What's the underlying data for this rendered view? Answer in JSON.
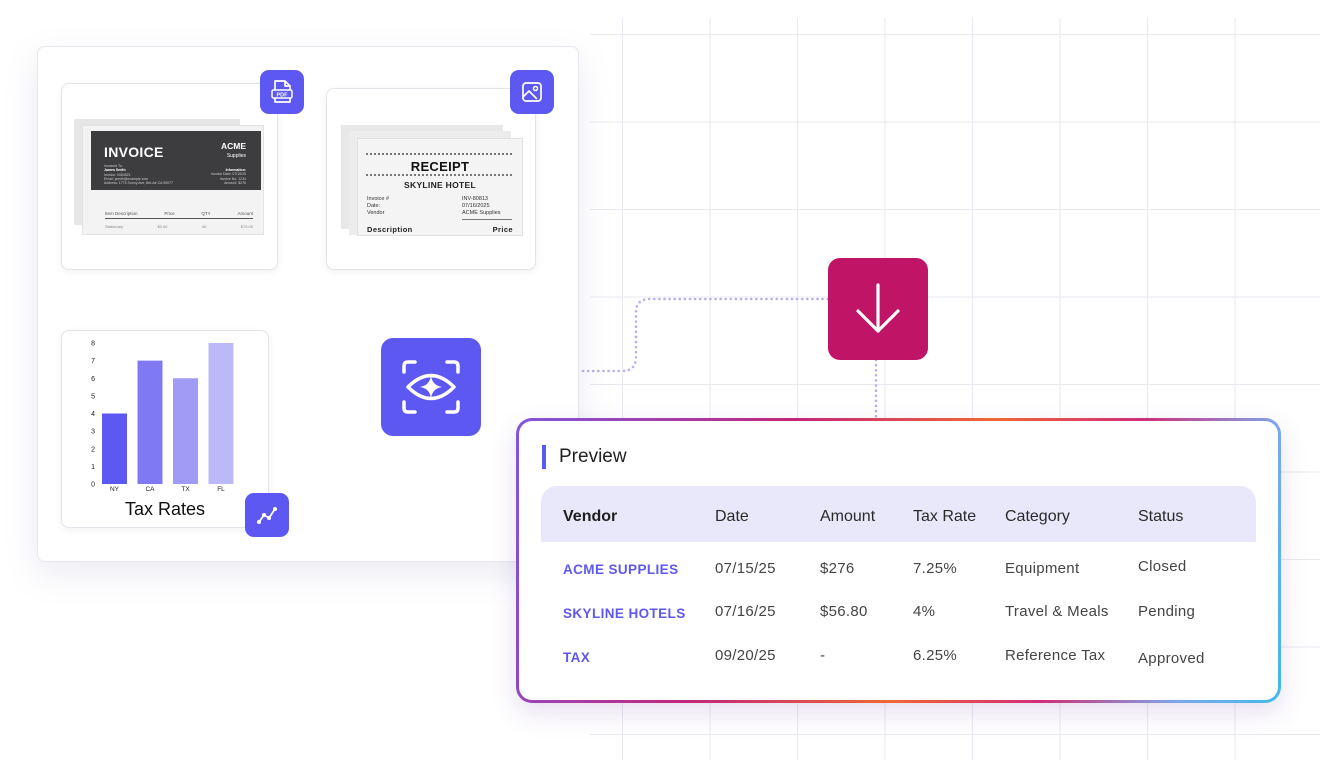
{
  "documents": {
    "invoice": {
      "badge_icon": "pdf-file-icon",
      "badge_text": "PDF",
      "title": "INVOICE",
      "brand_name": "ACME",
      "brand_sub": "Supplies",
      "billed_to": "Invoiced To:",
      "client": "James Smith",
      "line1": "Invoice: 0084521",
      "line2": "Email: jsmith@example.com",
      "line3": "Address: 1774 Sunny Ave, Bel-Air CA 90077",
      "info_label": "Information:",
      "info1": "Invoice Date: 07/15/25",
      "info2": "Invoice No: 1234",
      "info3": "Amount: $276",
      "col_desc": "Item Description",
      "col_price": "Price",
      "col_qty": "QTY",
      "col_amount": "Amount",
      "row_desc": "Stationary",
      "row_price": "$3.00",
      "row_qty": "40",
      "row_amount": "$70.00"
    },
    "receipt": {
      "badge_icon": "image-icon",
      "title": "RECEIPT",
      "subtitle": "SKYLINE HOTEL",
      "rows": [
        {
          "label": "Invoice #",
          "value": "INV-80813"
        },
        {
          "label": "Date:",
          "value": "07/16/2025"
        },
        {
          "label": "Vendor",
          "value": "ACME Supplies"
        }
      ],
      "col_desc": "Description",
      "col_price": "Price"
    }
  },
  "chart_data": {
    "type": "bar",
    "title": "Tax Rates",
    "categories": [
      "NY",
      "CA",
      "TX",
      "FL"
    ],
    "values": [
      4,
      7,
      6,
      8
    ],
    "ylim": [
      0,
      8
    ],
    "yticks": [
      0,
      1,
      2,
      3,
      4,
      5,
      6,
      7,
      8
    ],
    "colors": [
      "#5e58f2",
      "#7f7af4",
      "#a09cf6",
      "#bcb9f8"
    ],
    "grid": false,
    "badge_icon": "trend-line-icon"
  },
  "nodes": {
    "analyze_icon": "ai-eye-scan-icon",
    "download_icon": "arrow-down-icon",
    "analyze_color": "#5e58f2",
    "download_color": "#c01467"
  },
  "preview": {
    "title": "Preview",
    "columns": [
      "Vendor",
      "Date",
      "Amount",
      "Tax Rate",
      "Category",
      "Status"
    ],
    "rows": [
      {
        "vendor": "ACME SUPPLIES",
        "date": "07/15/25",
        "amount": "$276",
        "tax_rate": "7.25%",
        "category": "Equipment",
        "status": "Closed"
      },
      {
        "vendor": "SKYLINE HOTELS",
        "date": "07/16/25",
        "amount": "$56.80",
        "tax_rate": "4%",
        "category": "Travel & Meals",
        "status": "Pending"
      },
      {
        "vendor": "TAX",
        "date": "09/20/25",
        "amount": "-",
        "tax_rate": "6.25%",
        "category": "Reference Tax",
        "status": "Approved"
      }
    ]
  }
}
